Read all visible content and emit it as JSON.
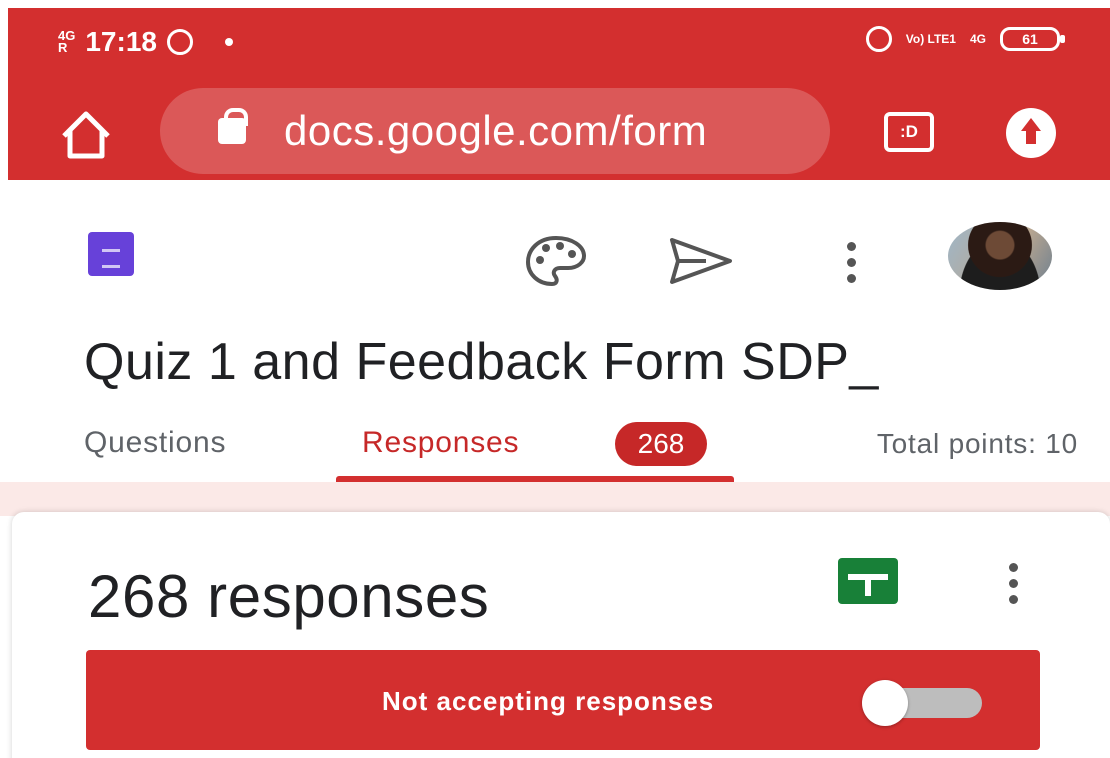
{
  "status_bar": {
    "network_left": "4G",
    "network_left2": "R",
    "time": "17:18",
    "network_right": "Vo) LTE1",
    "network_right2": "4G",
    "battery": "61"
  },
  "browser": {
    "url": "docs.google.com/form",
    "tab_switcher_label": ":D",
    "icons": [
      "home-icon",
      "lock-icon",
      "tab-switcher-icon",
      "upload-icon"
    ]
  },
  "form_header": {
    "icons": [
      "google-forms-icon",
      "palette-icon",
      "send-icon",
      "more-vert-icon",
      "avatar"
    ],
    "title": "Quiz 1 and Feedback Form SDP_"
  },
  "tabs": {
    "questions": "Questions",
    "responses": "Responses",
    "responses_count": "268",
    "total_points": "Total points: 10"
  },
  "responses_card": {
    "count_label": "268 responses",
    "accepting_label": "Not accepting responses",
    "accepting": false,
    "icons": [
      "google-sheets-icon",
      "more-vert-icon"
    ]
  },
  "colors": {
    "brand_red": "#d32f2f",
    "forms_purple": "#6741d9",
    "sheets_green": "#188038"
  }
}
